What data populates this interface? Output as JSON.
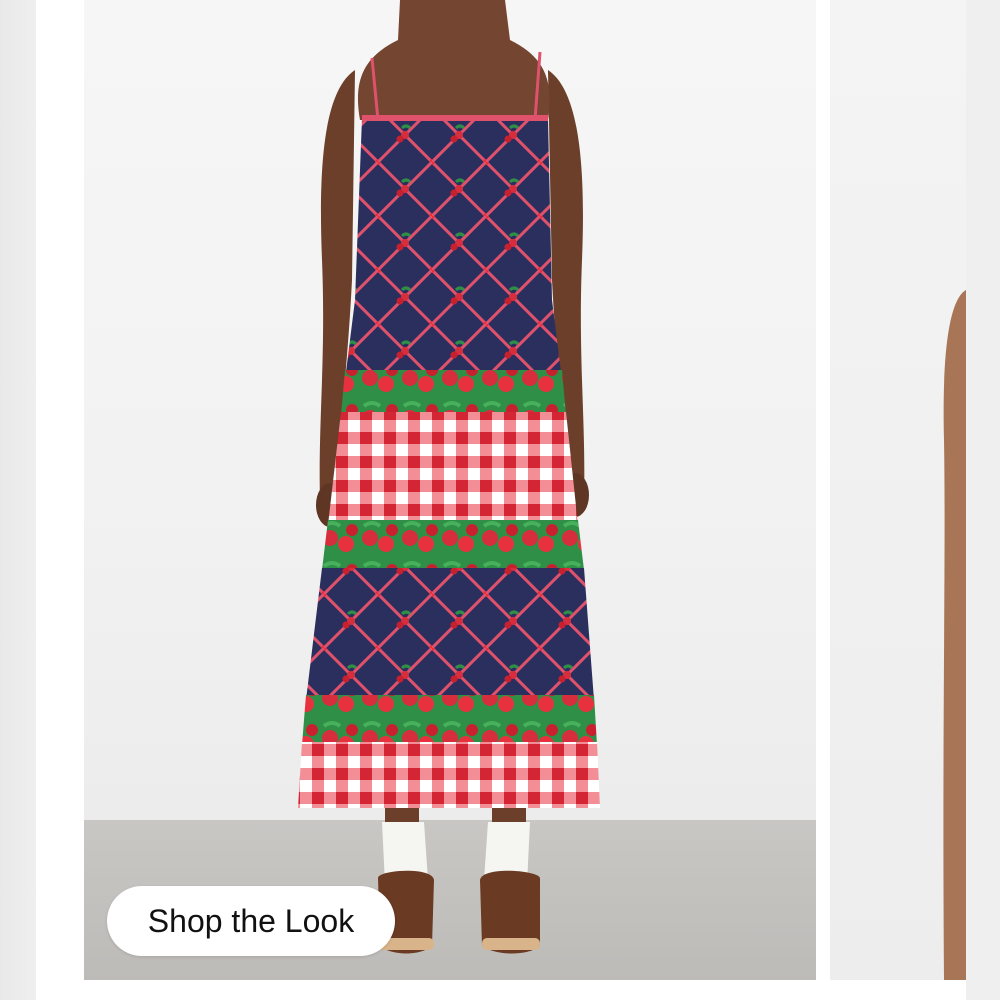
{
  "carousel": {
    "shop_button_label": "Shop the Look"
  },
  "product_image": {
    "icon": "dress-photo",
    "colors": {
      "navy": "#2b2f5e",
      "red": "#e8313f",
      "green": "#2f8f46",
      "white": "#ffffff"
    }
  }
}
